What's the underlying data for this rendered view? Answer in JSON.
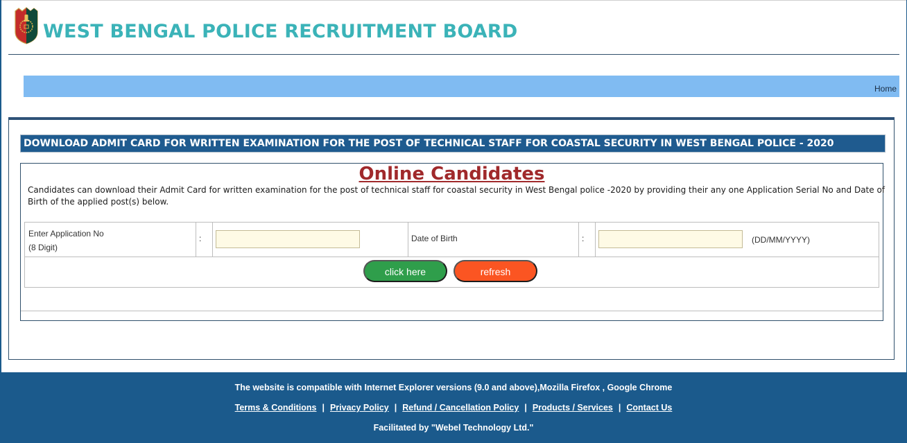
{
  "header": {
    "title": "WEST BENGAL POLICE RECRUITMENT BOARD",
    "logo_icon": "police-emblem-shield-icon"
  },
  "nav": {
    "home_label": "Home"
  },
  "main": {
    "title_bar": "DOWNLOAD ADMIT CARD FOR WRITTEN EXAMINATION FOR THE POST OF TECHNICAL STAFF FOR COASTAL SECURITY IN WEST BENGAL POLICE - 2020",
    "heading": "Online Candidates",
    "instructions": "Candidates can download their Admit Card for written examination for the post of technical staff for coastal security in West Bengal police -2020 by providing their any one Application Serial No and Date of Birth of the applied post(s) below.",
    "form": {
      "app_no_label": "Enter Application No",
      "app_no_sublabel": "(8 Digit)",
      "separator": ":",
      "app_no_value": "",
      "dob_label": "Date of Birth",
      "dob_value": "",
      "dob_hint": "(DD/MM/YYYY)",
      "submit_label": "click here",
      "refresh_label": "refresh"
    }
  },
  "footer": {
    "compat": "The website is compatible with Internet Explorer versions (9.0 and above),Mozilla Firefox , Google Chrome",
    "links": [
      "Terms & Conditions",
      "Privacy Policy",
      "Refund / Cancellation Policy",
      "Products / Services",
      "Contact Us"
    ],
    "link_separator": "|",
    "credit": "Facilitated by \"Webel Technology Ltd.\""
  },
  "colors": {
    "title_teal": "#3bb3b8",
    "nav_blue": "#80bbf2",
    "dark_blue": "#1b5a8c",
    "heading_red": "#a0292b",
    "submit_green": "#2f9e4b",
    "refresh_orange": "#fb5522",
    "input_bg": "#fefae5"
  }
}
